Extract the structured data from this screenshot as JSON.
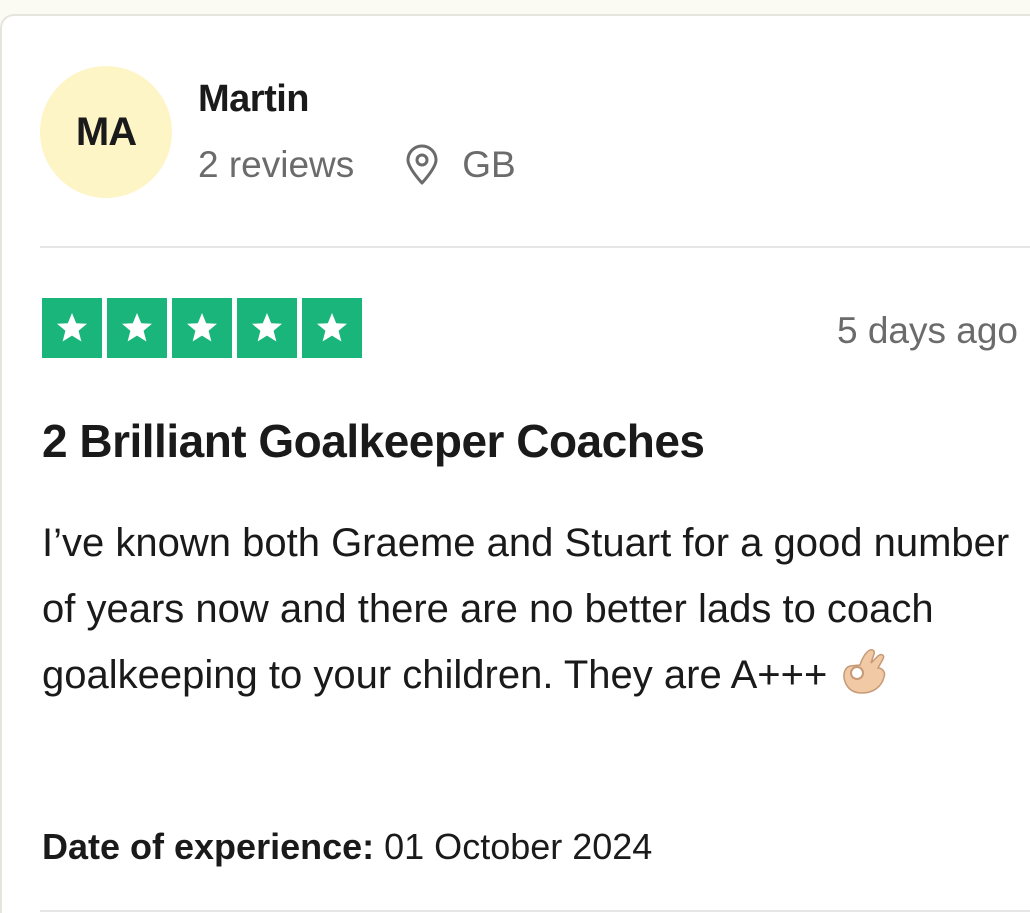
{
  "reviewer": {
    "initials": "MA",
    "name": "Martin",
    "reviews_count": "2 reviews",
    "country": "GB",
    "location_icon": "location-pin-icon"
  },
  "review": {
    "rating": 5,
    "rating_max": 5,
    "star_color": "#19b57a",
    "posted": "5 days ago",
    "title": "2 Brilliant Goalkeeper Coaches",
    "body": "I’ve known both Graeme and Stuart for a good number of years now and there are no better lads to coach goalkeeping to your children. They are A+++",
    "emoji_icon": "ok-hand-emoji-icon",
    "experience_label": "Date of experience:",
    "experience_date": "01 October 2024"
  },
  "colors": {
    "avatar_bg": "#fdf5c5",
    "muted_text": "#6b6b6b",
    "primary_text": "#1a1a1a"
  }
}
